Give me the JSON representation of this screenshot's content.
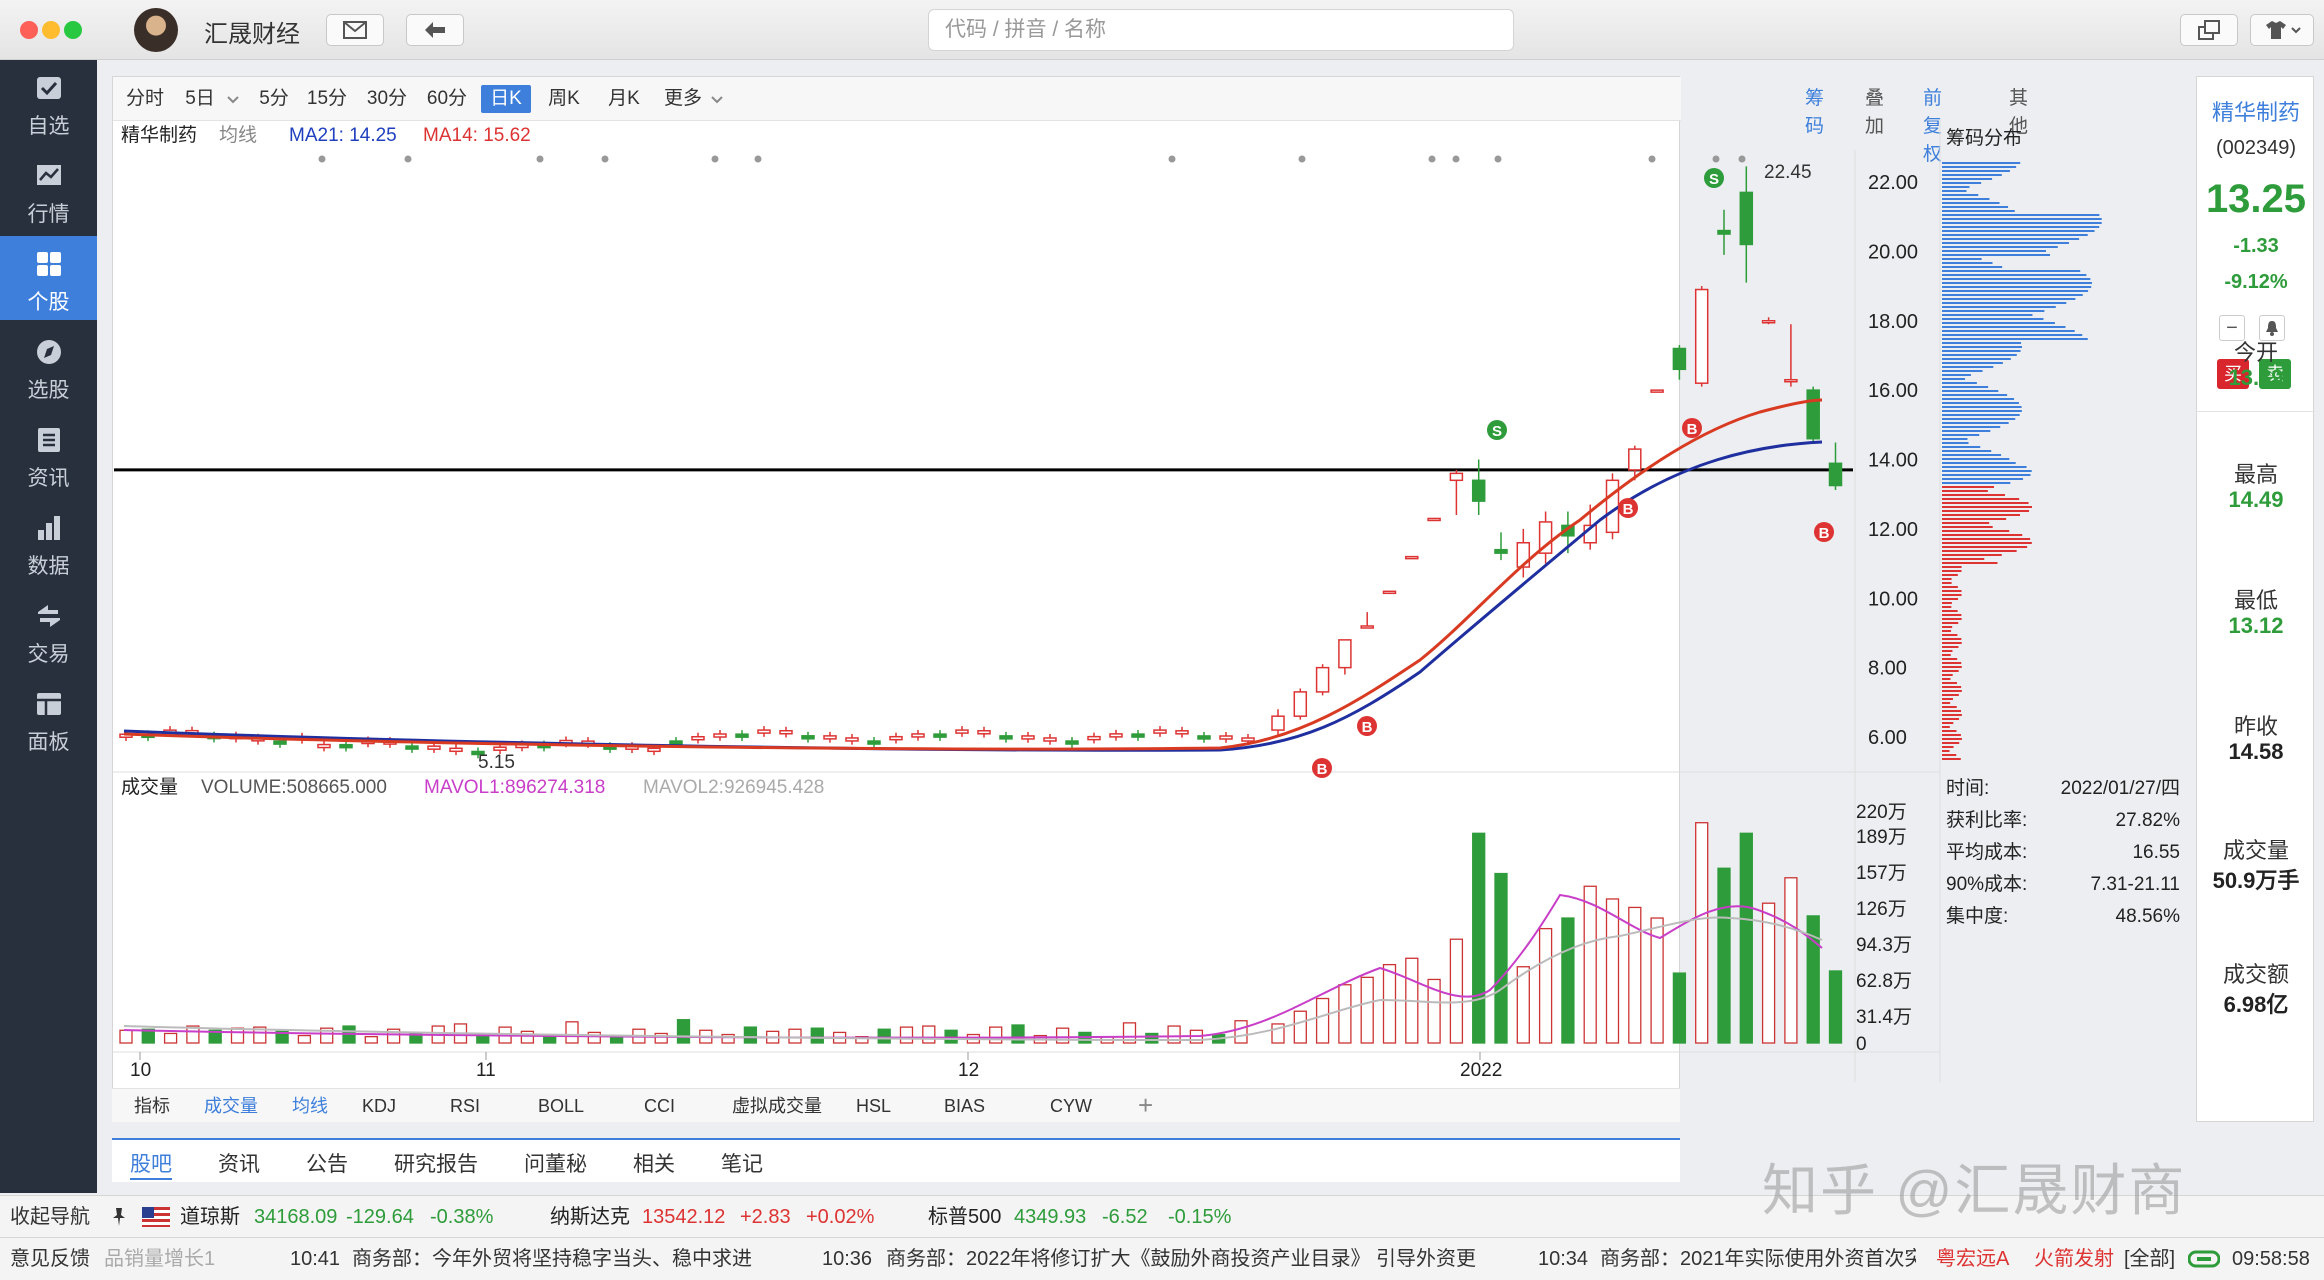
{
  "app": {
    "name": "汇晟财经",
    "search_placeholder": "代码 / 拼音 / 名称"
  },
  "nav": [
    {
      "label": "自选",
      "icon": "watchlist-icon"
    },
    {
      "label": "行情",
      "icon": "market-icon"
    },
    {
      "label": "个股",
      "icon": "stock-grid-icon"
    },
    {
      "label": "选股",
      "icon": "compass-icon"
    },
    {
      "label": "资讯",
      "icon": "news-icon"
    },
    {
      "label": "数据",
      "icon": "bar-chart-icon"
    },
    {
      "label": "交易",
      "icon": "trade-icon"
    },
    {
      "label": "面板",
      "icon": "panel-icon"
    }
  ],
  "periods": [
    "分时",
    "5日",
    "5分",
    "15分",
    "30分",
    "60分",
    "日K",
    "周K",
    "月K",
    "更多"
  ],
  "active_period": "日K",
  "right_tools": {
    "chips": "筹码",
    "overlay": "叠加",
    "adjust": "前复权",
    "other": "其他"
  },
  "stock": {
    "name": "精华制药",
    "code": "(002349)",
    "price": "13.25",
    "change": "-1.33",
    "change_pct": "-9.12%",
    "buy": "买",
    "sell": "卖"
  },
  "ma": {
    "type": "均线",
    "ma21": "MA21: 14.25",
    "ma14": "MA14: 15.62"
  },
  "chart_labels": {
    "high": "22.45",
    "low": "5.15"
  },
  "volume_bar": {
    "title": "成交量",
    "volume": "VOLUME:508665.000",
    "mavol1": "MAVOL1:896274.318",
    "mavol2": "MAVOL2:926945.428"
  },
  "chips": {
    "title": "筹码分布",
    "rows": [
      {
        "k": "时间:",
        "v": "2022/01/27/四"
      },
      {
        "k": "获利比率:",
        "v": "27.82%"
      },
      {
        "k": "平均成本:",
        "v": "16.55"
      },
      {
        "k": "90%成本:",
        "v": "7.31-21.11"
      },
      {
        "k": "集中度:",
        "v": "48.56%"
      }
    ]
  },
  "side_stats": [
    {
      "label": "今开",
      "value": "13.89",
      "color": "#2e9c3a"
    },
    {
      "label": "最高",
      "value": "14.49",
      "color": "#2e9c3a"
    },
    {
      "label": "最低",
      "value": "13.12",
      "color": "#2e9c3a"
    },
    {
      "label": "昨收",
      "value": "14.58",
      "color": "#222"
    },
    {
      "label": "成交量",
      "value": "50.9万手",
      "color": "#222"
    },
    {
      "label": "成交额",
      "value": "6.98亿",
      "color": "#222"
    }
  ],
  "indicator_tabs": [
    "指标",
    "成交量",
    "均线",
    "KDJ",
    "RSI",
    "BOLL",
    "CCI",
    "虚拟成交量",
    "HSL",
    "BIAS",
    "CYW"
  ],
  "bottom_tabs": [
    "股吧",
    "资讯",
    "公告",
    "研究报告",
    "问董秘",
    "相关",
    "笔记"
  ],
  "ticker": {
    "collapse": "收起导航",
    "items": [
      {
        "name": "道琼斯",
        "value": "34168.09",
        "change": "-129.64",
        "pct": "-0.38%",
        "up": false
      },
      {
        "name": "纳斯达克",
        "value": "13542.12",
        "change": "+2.83",
        "pct": "+0.02%",
        "up": true
      },
      {
        "name": "标普500",
        "value": "4349.93",
        "change": "-6.52",
        "pct": "-0.15%",
        "up": false
      }
    ]
  },
  "news": {
    "feedback": "意见反馈",
    "frag": "品销量增长1",
    "items": [
      {
        "time": "10:41",
        "text": "商务部：今年外贸将坚持稳字当头、稳中求进"
      },
      {
        "time": "10:36",
        "text": "商务部：2022年将修订扩大《鼓励外商投资产业目录》 引导外资更"
      },
      {
        "time": "10:34",
        "text": "商务部：2021年实际使用外资首次突"
      }
    ],
    "stock1": "粤宏远A",
    "stock2": "火箭发射",
    "all": "[全部]",
    "clock": "09:58:58"
  },
  "watermark": "知乎 @汇晟财商",
  "chart_data": {
    "type": "candlestick",
    "y_axis_ticks": [
      "22.00",
      "20.00",
      "18.00",
      "16.00",
      "14.00",
      "12.00",
      "10.00",
      "8.00",
      "6.00"
    ],
    "volume_axis_ticks": [
      "220万",
      "189万",
      "157万",
      "126万",
      "94.3万",
      "62.8万",
      "31.4万",
      "0"
    ],
    "x_axis_ticks": [
      "10",
      "11",
      "12",
      "2022"
    ],
    "high_marker": 22.45,
    "low_marker": 5.15,
    "reference_line": 13.7,
    "candles_recent": [
      {
        "o": 6.2,
        "c": 6.6,
        "h": 6.8,
        "l": 6.0
      },
      {
        "o": 6.6,
        "c": 7.3,
        "h": 7.4,
        "l": 6.5
      },
      {
        "o": 7.3,
        "c": 8.0,
        "h": 8.1,
        "l": 7.2
      },
      {
        "o": 8.0,
        "c": 8.8,
        "h": 8.8,
        "l": 7.8
      },
      {
        "o": 9.2,
        "c": 9.2,
        "h": 9.6,
        "l": 9.2
      },
      {
        "o": 10.2,
        "c": 10.2,
        "h": 10.2,
        "l": 10.2
      },
      {
        "o": 11.2,
        "c": 11.2,
        "h": 11.2,
        "l": 11.2
      },
      {
        "o": 12.3,
        "c": 12.3,
        "h": 12.3,
        "l": 12.3
      },
      {
        "o": 13.4,
        "c": 13.6,
        "h": 13.7,
        "l": 12.4
      },
      {
        "o": 13.4,
        "c": 12.8,
        "h": 14.0,
        "l": 12.4
      },
      {
        "o": 11.4,
        "c": 11.3,
        "h": 11.9,
        "l": 11.1
      },
      {
        "o": 10.9,
        "c": 11.6,
        "h": 12.0,
        "l": 10.6
      },
      {
        "o": 11.3,
        "c": 12.2,
        "h": 12.5,
        "l": 11.0
      },
      {
        "o": 12.1,
        "c": 11.8,
        "h": 12.5,
        "l": 11.3
      },
      {
        "o": 11.6,
        "c": 12.1,
        "h": 12.7,
        "l": 11.4
      },
      {
        "o": 11.9,
        "c": 13.4,
        "h": 13.6,
        "l": 11.7
      },
      {
        "o": 13.7,
        "c": 14.3,
        "h": 14.4,
        "l": 13.4
      },
      {
        "o": 16.0,
        "c": 16.0,
        "h": 16.0,
        "l": 16.0
      },
      {
        "o": 17.2,
        "c": 16.6,
        "h": 17.3,
        "l": 16.3
      },
      {
        "o": 16.2,
        "c": 18.9,
        "h": 19.0,
        "l": 16.1
      },
      {
        "o": 20.6,
        "c": 20.5,
        "h": 21.2,
        "l": 19.9
      },
      {
        "o": 21.7,
        "c": 20.2,
        "h": 22.45,
        "l": 19.1
      },
      {
        "o": 18.0,
        "c": 18.0,
        "h": 18.1,
        "l": 17.9
      },
      {
        "o": 16.3,
        "c": 16.3,
        "h": 17.9,
        "l": 16.1
      },
      {
        "o": 16.0,
        "c": 14.6,
        "h": 16.1,
        "l": 14.5
      },
      {
        "o": 13.89,
        "c": 13.25,
        "h": 14.49,
        "l": 13.12
      }
    ],
    "volumes_recent_wan": [
      18,
      30,
      42,
      55,
      62,
      74,
      80,
      60,
      98,
      198,
      160,
      72,
      108,
      118,
      148,
      136,
      128,
      118,
      66,
      208,
      165,
      198,
      132,
      156,
      120,
      68
    ],
    "series": [
      {
        "name": "MA21"
      },
      {
        "name": "MA14"
      }
    ]
  }
}
